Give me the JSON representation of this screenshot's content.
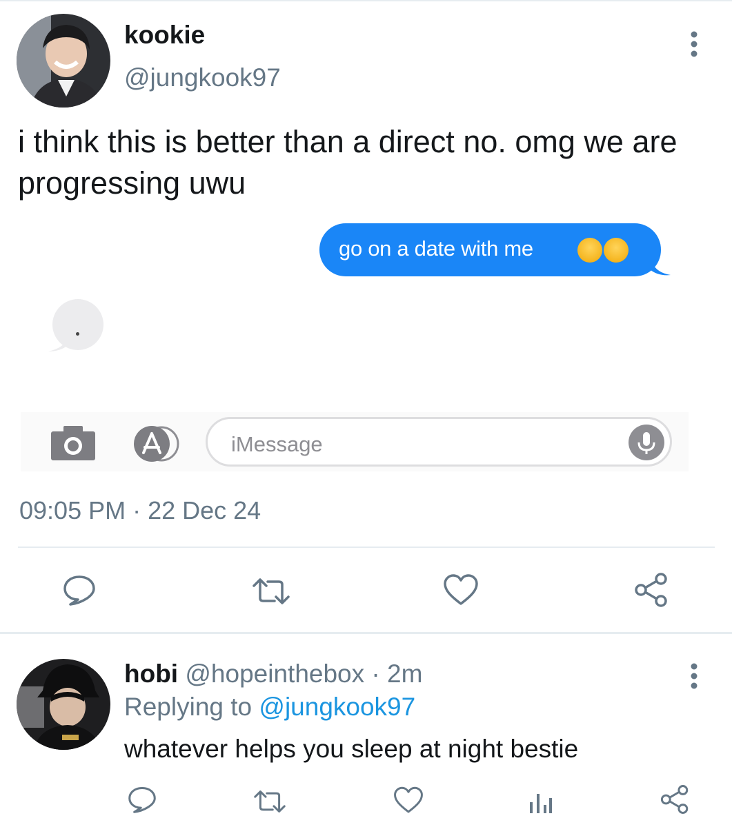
{
  "tweet": {
    "display_name": "kookie",
    "handle": "@jungkook97",
    "text": "i think this is better than a direct no. omg we are progressing uwu",
    "timestamp": "09:05 PM · 22 Dec 24"
  },
  "imessage": {
    "sent_message": "go on a date with me",
    "sent_emoji": [
      "smiling-face-with-hearts",
      "smiling-face-with-hearts"
    ],
    "input_placeholder": "iMessage",
    "accent_color": "#1a86f7"
  },
  "actions": [
    "reply-icon",
    "retweet-icon",
    "like-icon",
    "share-icon"
  ],
  "reply": {
    "display_name": "hobi",
    "handle": "@hopeinthebox",
    "separator": " · ",
    "time": "2m",
    "replying_prefix": "Replying to ",
    "replying_to": "@jungkook97",
    "text": "whatever helps you sleep at night bestie",
    "actions": [
      "reply-icon",
      "retweet-icon",
      "like-icon",
      "analytics-icon",
      "share-icon"
    ]
  },
  "colors": {
    "text_primary": "#14171a",
    "text_secondary": "#657786",
    "link": "#1b95e0",
    "divider": "#e6ecf0"
  }
}
